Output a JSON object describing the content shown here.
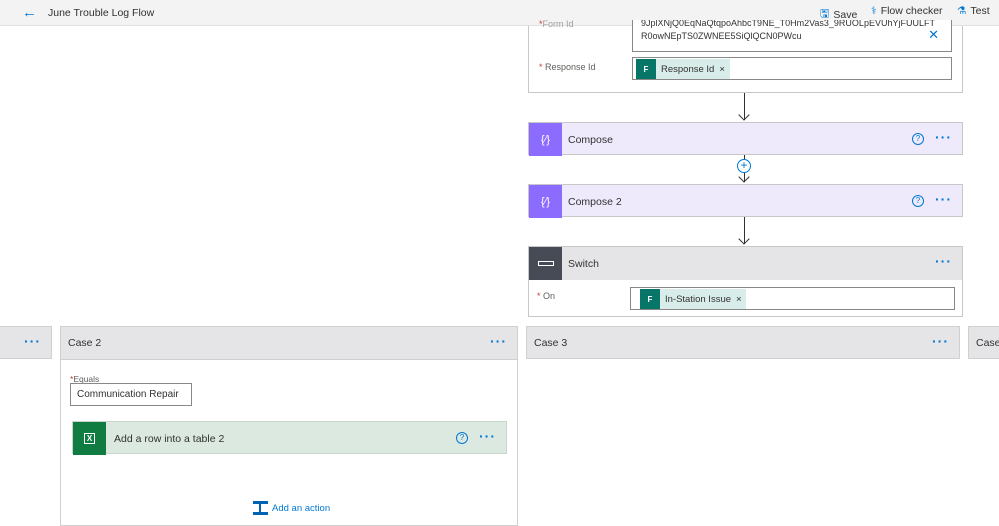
{
  "header": {
    "title": "June Trouble Log Flow",
    "save": "Save",
    "flow_checker": "Flow checker",
    "test": "Test"
  },
  "forms_card": {
    "form_id_label": "Form Id",
    "form_id_value_line1": "9JplXNjQ0EqNaQtqpoAhbcT9NE_T0Hm2Vas3_9RUOLpEVUhYjFUULFT",
    "form_id_value_line2": "R0owNEpTS0ZWNEE5SiQlQCN0PWcu",
    "response_id_label": "Response Id",
    "response_id_token": "Response Id"
  },
  "compose": {
    "title": "Compose"
  },
  "compose2": {
    "title": "Compose 2"
  },
  "switch": {
    "title": "Switch",
    "on_label": "On",
    "on_token": "In-Station Issue"
  },
  "cases": {
    "case2": {
      "title": "Case 2",
      "equals_label": "Equals",
      "equals_value": "Communication Repair",
      "action_title": "Add a row into a table 2",
      "add_action": "Add an action"
    },
    "case3": {
      "title": "Case 3"
    },
    "case_next": {
      "title": "Case"
    }
  },
  "colors": {
    "compose_icon": "#8c6cff",
    "compose_bg": "#eeeafc",
    "switch_icon": "#474b55",
    "excel": "#107c41",
    "forms": "#077568",
    "accent": "#0078d4"
  }
}
